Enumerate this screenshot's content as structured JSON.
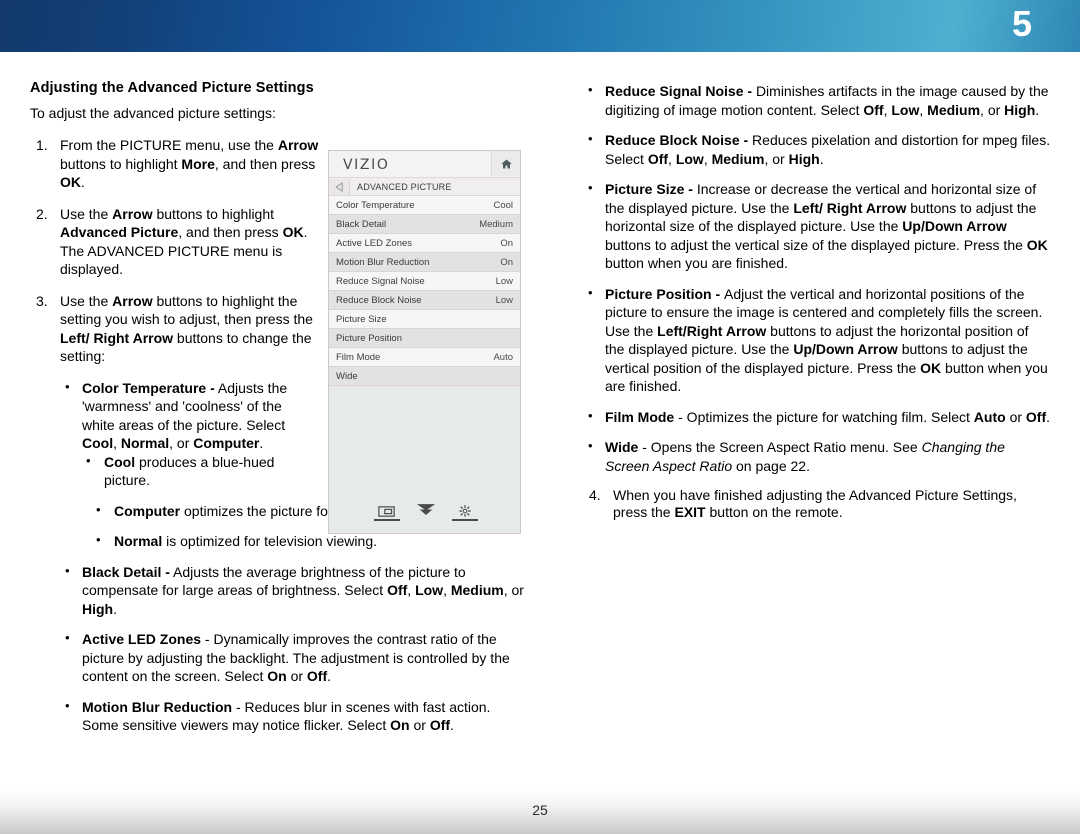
{
  "banner": {
    "chapter_number": "5"
  },
  "footer": {
    "page_number": "25"
  },
  "left": {
    "title": "Adjusting the Advanced Picture Settings",
    "intro": "To adjust the advanced picture settings:",
    "steps": [
      {
        "number": "1.",
        "html": "From the PICTURE menu, use the <b>Arrow</b> buttons to highlight <b>More</b>, and then press <b>OK</b>."
      },
      {
        "number": "2.",
        "html": "Use the <b>Arrow</b> buttons to highlight <b>Advanced Picture</b>, and then press <b>OK</b>. The ADVANCED PICTURE menu is displayed."
      },
      {
        "number": "3.",
        "html": "Use the <b>Arrow</b> buttons to highlight the setting you wish to adjust, then press the <b>Left/ Right Arrow</b> buttons to change the setting:"
      }
    ],
    "bullets_narrow": [
      {
        "html": "<b>Color Temperature -</b> Adjusts the 'warmness' and 'coolness' of the white areas of the picture. Select <b>Cool</b>, <b>Normal</b>, or <b>Computer</b>.",
        "sub": [
          "<b>Cool</b> produces a blue-hued picture."
        ]
      }
    ],
    "bullets_wide": [
      {
        "html": "<b>Computer</b> optimizes the picture for use as a PC monitor."
      },
      {
        "html": "<b>Normal</b> is optimized for television viewing."
      }
    ],
    "bullets_bottom": [
      {
        "html": "<b>Black Detail -</b> Adjusts the average brightness of the picture to compensate for large areas of brightness. Select <b>Off</b>, <b>Low</b>, <b>Medium</b>, or <b>High</b>."
      },
      {
        "html": "<b>Active LED Zones</b> - Dynamically improves the contrast ratio of the picture by adjusting the backlight. The adjustment is controlled by the content on the screen. Select <b>On</b> or <b>Off</b>."
      },
      {
        "html": "<b>Motion Blur Reduction</b> - Reduces blur in scenes with fast action. Some sensitive viewers may notice flicker. Select <b>On</b> or <b>Off</b>."
      }
    ]
  },
  "right": {
    "bullets": [
      {
        "html": "<b>Reduce Signal Noise - </b>Diminishes artifacts in the image caused by the digitizing of image motion content. Select <b>Off</b>, <b>Low</b>, <b>Medium</b>, or <b>High</b>."
      },
      {
        "html": "<b>Reduce Block Noise - </b>Reduces pixelation and distortion for mpeg files. Select <b>Off</b>, <b>Low</b>, <b>Medium</b>, or <b>High</b>."
      },
      {
        "html": "<b>Picture Size - </b>Increase or decrease the vertical and horizontal size of the displayed picture. Use the <b>Left/ Right Arrow</b> buttons to adjust the horizontal size of the displayed picture. Use the <b>Up/Down Arrow</b> buttons to adjust the vertical size of the displayed picture. Press the <b>OK</b> button when you are finished."
      },
      {
        "html": "<b>Picture Position - </b>Adjust the vertical and horizontal positions of the picture to ensure the image is centered and completely fills the screen. Use the <b>Left/Right Arrow</b> buttons to adjust the horizontal position of the displayed picture. Use the <b>Up/Down Arrow</b> buttons to adjust the vertical position of the displayed picture. Press the <b>OK</b> button when you are finished."
      },
      {
        "html": "<b>Film Mode</b> - Optimizes the picture for watching film. Select <b>Auto</b> or <b>Off</b>."
      },
      {
        "html": "<b>Wide</b> - Opens the Screen Aspect Ratio menu. See <i>Changing the Screen Aspect Ratio</i> on page 22."
      }
    ],
    "step": {
      "number": "4.",
      "html": "When you have finished adjusting the Advanced Picture Settings, press the <b>EXIT</b> button on the remote."
    }
  },
  "tv_menu": {
    "brand": "VIZIO",
    "home_icon": "home-icon",
    "back_icon": "back-arrow-icon",
    "title": "ADVANCED PICTURE",
    "rows": [
      {
        "label": "Color Temperature",
        "value": "Cool"
      },
      {
        "label": "Black Detail",
        "value": "Medium"
      },
      {
        "label": "Active LED Zones",
        "value": "On"
      },
      {
        "label": "Motion Blur Reduction",
        "value": "On"
      },
      {
        "label": "Reduce Signal Noise",
        "value": "Low"
      },
      {
        "label": "Reduce Block Noise",
        "value": "Low"
      },
      {
        "label": "Picture Size",
        "value": ""
      },
      {
        "label": "Picture Position",
        "value": ""
      },
      {
        "label": "Film Mode",
        "value": "Auto"
      },
      {
        "label": "Wide",
        "value": ""
      }
    ],
    "footer_icons": [
      "picture-mode-icon",
      "chevron-double-down-icon",
      "settings-gear-icon"
    ]
  }
}
